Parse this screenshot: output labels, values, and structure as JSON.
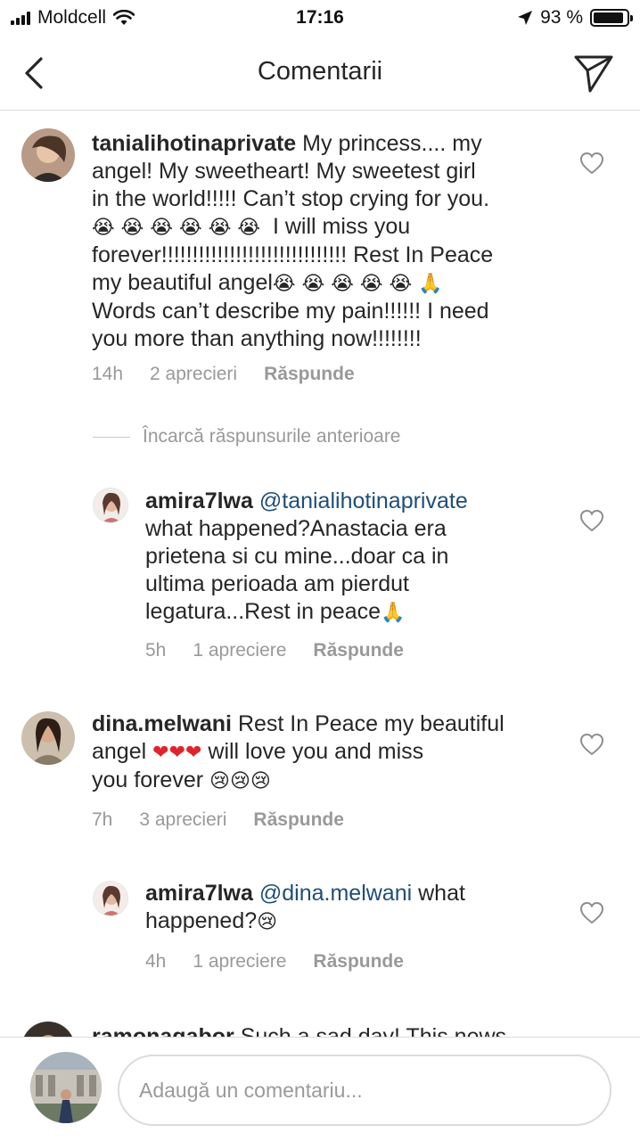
{
  "status_bar": {
    "carrier": "Moldcell",
    "time": "17:16",
    "battery_text": "93 %",
    "battery_level": 0.93
  },
  "header": {
    "title": "Comentarii"
  },
  "comments": [
    {
      "username": "tanialihotinaprivate",
      "text_lines": [
        "My princess.... my",
        "angel! My sweetheart! My sweetest girl",
        "in the world!!!!! Can’t stop crying for you.",
        "I will miss you",
        "forever!!!!!!!!!!!!!!!!!!!!!!!!!!!!!! Rest In Peace",
        "my beautiful angel",
        "Words can’t describe my pain!!!!!! I need",
        "you more than anything now!!!!!!!!"
      ],
      "emoji_crying": "😭",
      "emoji_pray": "🙏",
      "time": "14h",
      "likes": "2 aprecieri",
      "reply": "Răspunde"
    },
    {
      "username": "amira7lwa",
      "mention": "@tanialihotinaprivate",
      "text_lines": [
        "what happened?Anastacia era",
        "prietena si cu mine...doar ca in",
        "ultima perioada am pierdut",
        "legatura...Rest in peace"
      ],
      "emoji_pray": "🙏",
      "time": "5h",
      "likes": "1 apreciere",
      "reply": "Răspunde"
    },
    {
      "username": "dina.melwani",
      "text_lines": [
        "Rest In Peace my beautiful",
        "angel",
        "will love you and miss",
        "you forever"
      ],
      "emoji_heart": "❤",
      "emoji_sad": "😢",
      "time": "7h",
      "likes": "3 aprecieri",
      "reply": "Răspunde"
    },
    {
      "username": "amira7lwa",
      "mention": "@dina.melwani",
      "text_lines": [
        "what",
        "happened?"
      ],
      "emoji_sad": "😢",
      "time": "4h",
      "likes": "1 apreciere",
      "reply": "Răspunde"
    },
    {
      "username": "ramonagabor",
      "text_lines": [
        "Such a sad day! This news"
      ]
    }
  ],
  "load_previous": "Încarcă răspunsurile anterioare",
  "input": {
    "placeholder": "Adaugă un comentariu..."
  },
  "icons": {
    "back": "chevron-left-icon",
    "send": "paper-plane-icon",
    "like": "heart-outline-icon"
  }
}
